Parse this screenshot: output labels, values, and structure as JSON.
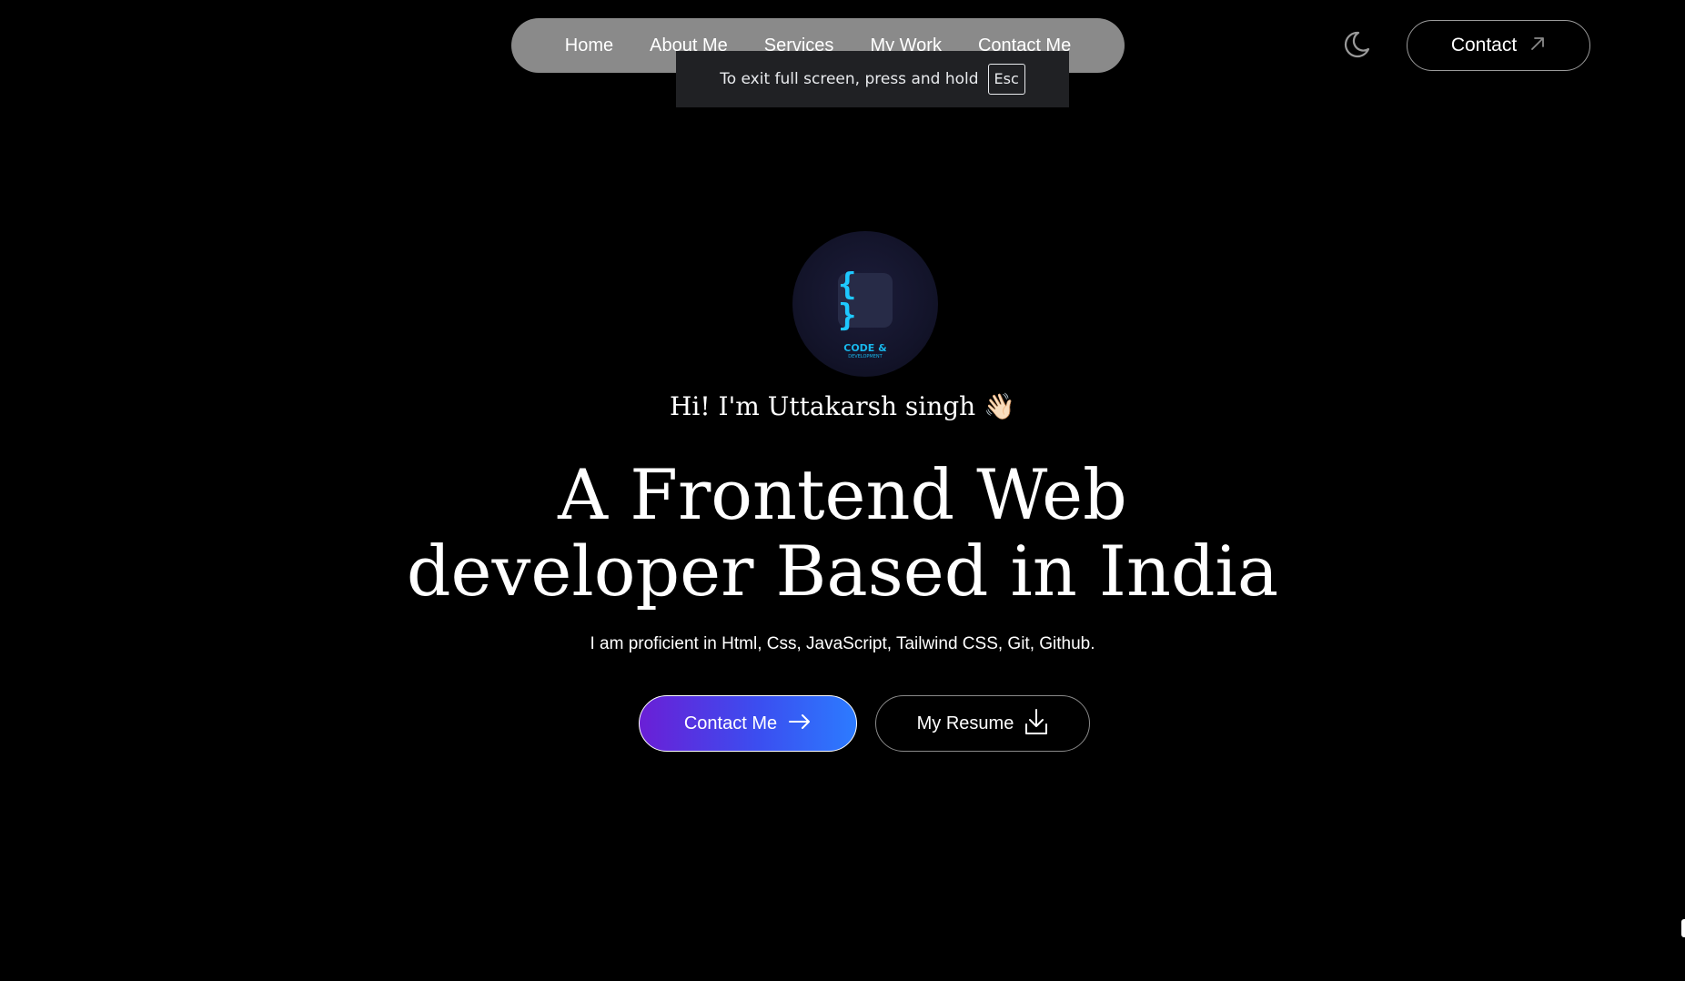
{
  "nav": {
    "links": [
      "Home",
      "About Me",
      "Services",
      "My Work",
      "Contact Me"
    ]
  },
  "fullscreen_toast": {
    "text": "To exit full screen, press and hold",
    "key": "Esc"
  },
  "header": {
    "theme_icon": "moon-icon",
    "contact_label": "Contact",
    "contact_icon": "arrow-up-right-icon"
  },
  "hero": {
    "logo": {
      "braces": "{ }",
      "text": "CODE &",
      "subtext": "DEVELOPMENT"
    },
    "greeting": "Hi! I'm Uttakarsh singh",
    "greeting_emoji": "👋🏻",
    "headline_line1": "A Frontend Web",
    "headline_line2": "developer Based in India",
    "skills": "I am proficient in Html, Css, JavaScript, Tailwind CSS, Git, Github.",
    "primary_cta": "Contact Me",
    "primary_cta_icon": "arrow-right-icon",
    "secondary_cta": "My Resume",
    "secondary_cta_icon": "download-icon"
  },
  "colors": {
    "background": "#000000",
    "nav_pill": "#8a8a8a",
    "cta_gradient_start": "#6a1fd6",
    "cta_gradient_end": "#2c7bff",
    "logo_accent": "#1ec8ff"
  }
}
